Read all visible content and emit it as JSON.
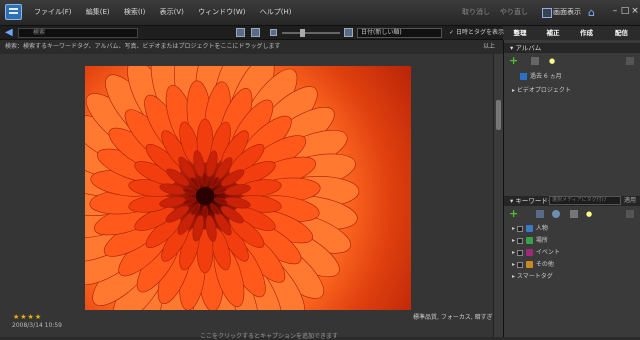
{
  "menu": {
    "items": [
      "ファイル(F)",
      "編集(E)",
      "検索(I)",
      "表示(V)",
      "ウィンドウ(W)",
      "ヘルプ(H)"
    ],
    "undo": "取り消し",
    "redo": "やり直し",
    "screen_view": "画面表示",
    "system_buttons": [
      "–",
      "□",
      "×"
    ]
  },
  "toolbar": {
    "search_placeholder": "検索",
    "sort": "日付(新しい順)",
    "show_tags": "日時とタグを表示"
  },
  "tabs": [
    {
      "label": "整理",
      "color": "#2d6ed0"
    },
    {
      "label": "補正",
      "color": "#d08b18"
    },
    {
      "label": "作成",
      "color": "#8a1e1e"
    },
    {
      "label": "配信",
      "color": "#5a8c28"
    }
  ],
  "hint": {
    "text": "検索：検索するキーワードタグ、アルバム、写真、ビデオまたはプロジェクトをここにドラッグします",
    "right": "以上"
  },
  "photo": {
    "rating": "★★★★",
    "date": "2008/3/14 10:59",
    "badge": "標準品質, フォーカス, 暗すぎる",
    "caption": "ここをクリックするとキャプションを追加できます"
  },
  "album_panel": {
    "title": "アルバム",
    "items": [
      "過去 6 ヵ月",
      "ビデオプロジェクト"
    ]
  },
  "keyword_panel": {
    "title": "キーワードタグ",
    "filter_placeholder": "選択メディアにタグ付け",
    "apply": "適用",
    "items": [
      {
        "label": "人物",
        "color": "#3a78c8"
      },
      {
        "label": "場所",
        "color": "#3aa04a"
      },
      {
        "label": "イベント",
        "color": "#a0287a"
      },
      {
        "label": "その他",
        "color": "#c88a20"
      },
      {
        "label": "スマートタグ",
        "color": ""
      }
    ]
  }
}
